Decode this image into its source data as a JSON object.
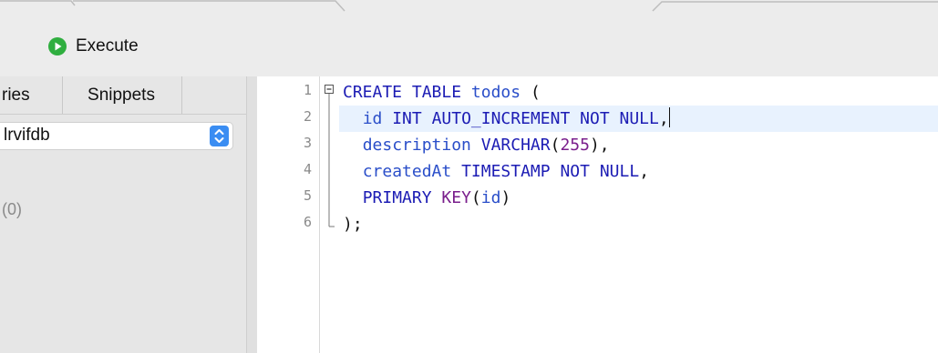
{
  "toolbar": {
    "execute_label": "Execute"
  },
  "sidebar": {
    "tabs": [
      {
        "label": "ries"
      },
      {
        "label": "Snippets"
      }
    ],
    "database_select": {
      "value": "lrvifdb"
    },
    "count_text": "(0)"
  },
  "editor": {
    "line_numbers": [
      "1",
      "2",
      "3",
      "4",
      "5",
      "6"
    ],
    "lines": [
      "CREATE TABLE todos (",
      "  id INT AUTO_INCREMENT NOT NULL,",
      "  description VARCHAR(255),",
      "  createdAt TIMESTAMP NOT NULL,",
      "  PRIMARY KEY(id)",
      ");"
    ],
    "tokens": {
      "l1": [
        "CREATE",
        "TABLE",
        "todos",
        "("
      ],
      "l2": [
        "id",
        "INT",
        "AUTO_INCREMENT",
        "NOT",
        "NULL",
        ","
      ],
      "l3": [
        "description",
        "VARCHAR",
        "(",
        "255",
        "),"
      ],
      "l4": [
        "createdAt",
        "TIMESTAMP",
        "NOT",
        "NULL",
        ","
      ],
      "l5": [
        "PRIMARY",
        "KEY",
        "(",
        "id",
        ")"
      ],
      "l6": [
        ");"
      ]
    },
    "current_line": 2
  },
  "colors": {
    "keyword": "#1c1cb4",
    "type": "#7a1f8c",
    "identifier": "#2a4ec9",
    "current_line_highlight": "#e8f2fe",
    "execute_icon": "#2fae3f",
    "select_arrow": "#3a8df2"
  },
  "icons": {
    "execute": "play-circle-icon",
    "select_arrow": "up-down-chevron-icon",
    "fold": "fold-minus-icon"
  }
}
